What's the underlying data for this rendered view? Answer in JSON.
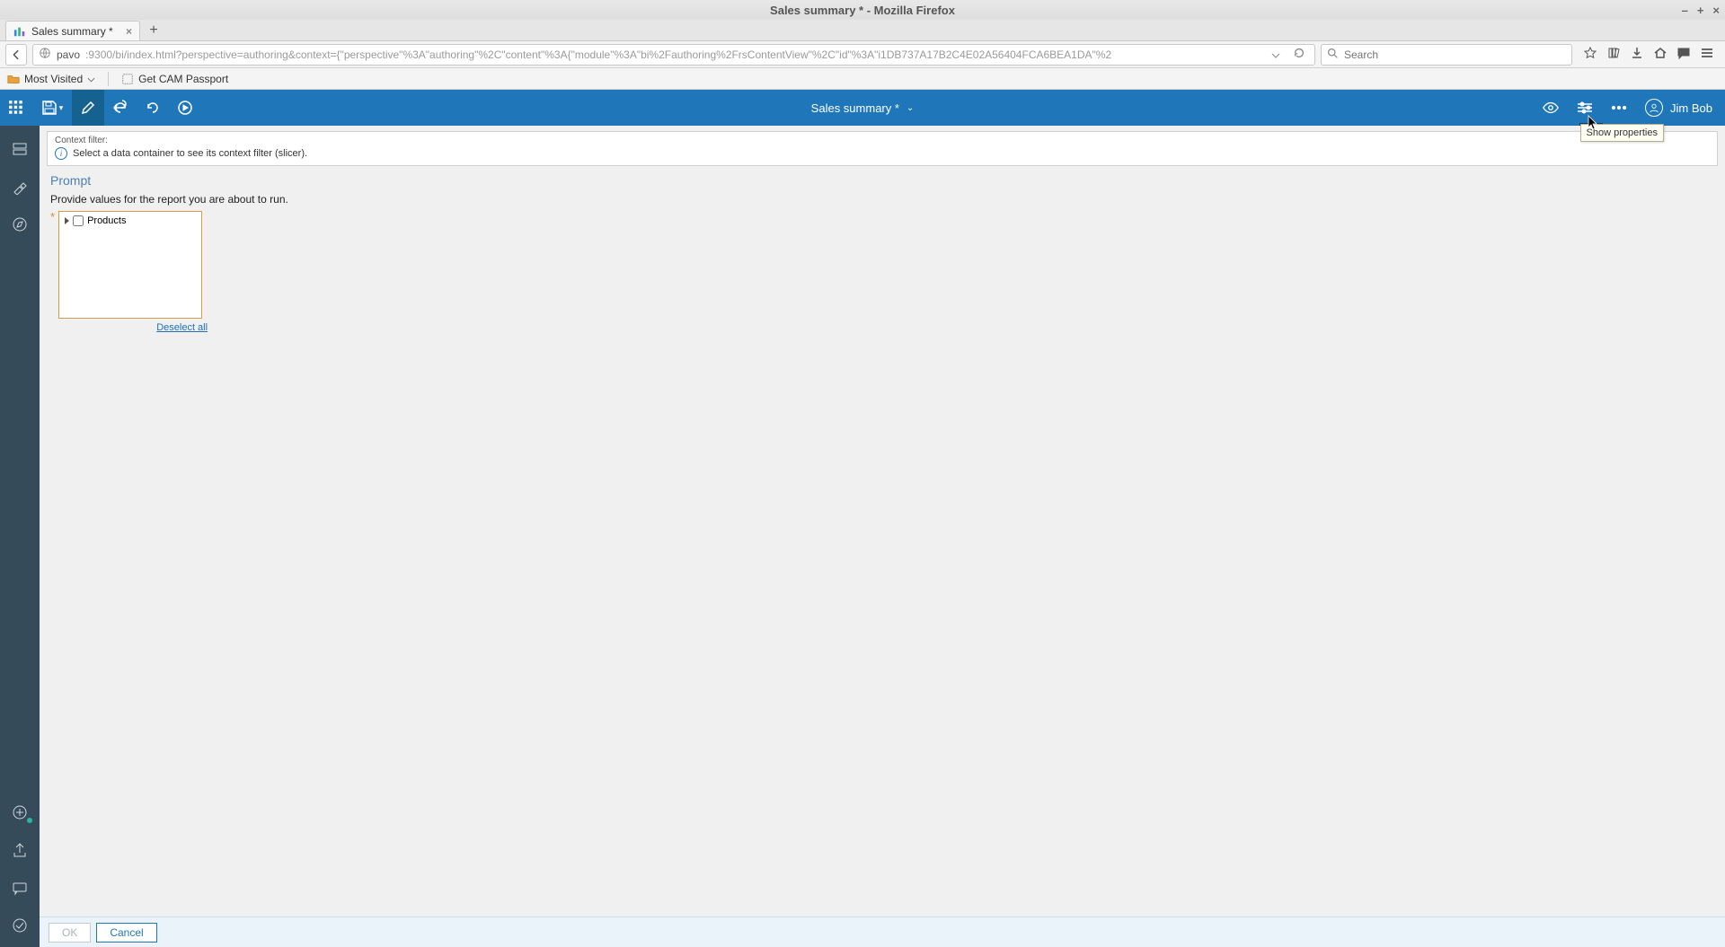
{
  "os": {
    "window_title": "Sales summary * - Mozilla Firefox",
    "minimize": "–",
    "maximize": "+",
    "close": "×"
  },
  "browser": {
    "tab_title": "Sales summary *",
    "tab_close": "×",
    "new_tab": "+",
    "url_host": "pavo",
    "url_path": ":9300/bi/index.html?perspective=authoring&context={\"perspective\"%3A\"authoring\"%2C\"content\"%3A{\"module\"%3A\"bi%2Fauthoring%2FrsContentView\"%2C\"id\"%3A\"i1DB737A17B2C4E02A56404FCA6BEA1DA\"%2",
    "search_placeholder": "Search",
    "bookmarks": {
      "most_visited": "Most Visited",
      "get_cam_passport": "Get CAM Passport"
    }
  },
  "app": {
    "document_title": "Sales summary *",
    "user_name": "Jim Bob",
    "tooltip_show_properties": "Show properties"
  },
  "context_filter": {
    "label": "Context filter:",
    "message": "Select a data container to see its context filter (slicer)."
  },
  "prompt": {
    "title": "Prompt",
    "description": "Provide values for the report you are about to run.",
    "tree_root": "Products",
    "deselect_all": "Deselect all",
    "ok_label": "OK",
    "cancel_label": "Cancel"
  }
}
